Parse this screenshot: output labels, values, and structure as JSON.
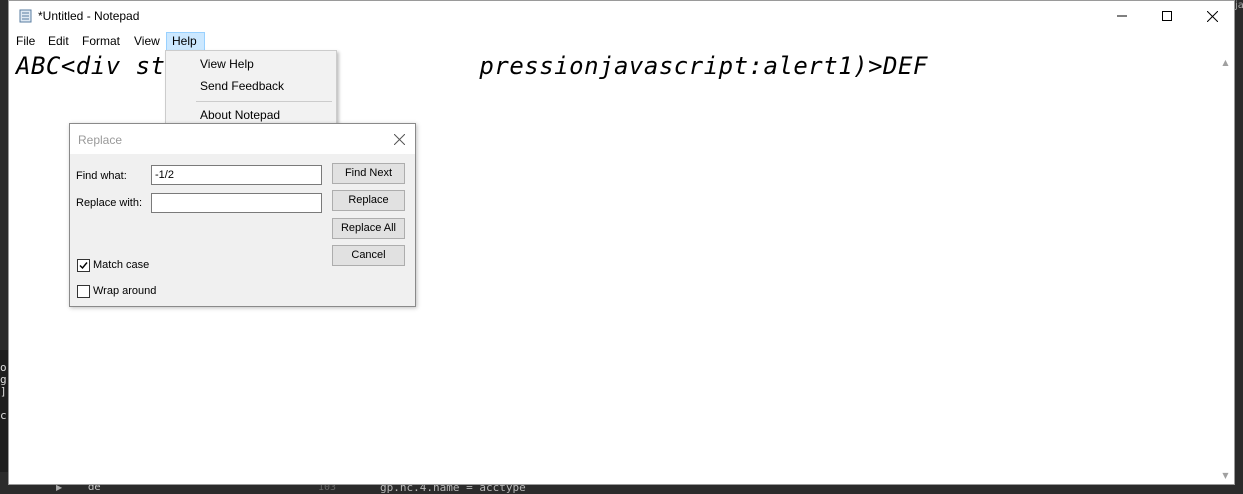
{
  "window": {
    "title": "*Untitled - Notepad",
    "controls": {
      "minimize_icon": "minimize-icon",
      "maximize_icon": "maximize-icon",
      "close_icon": "close-icon"
    }
  },
  "menubar": {
    "items": [
      {
        "label": "File"
      },
      {
        "label": "Edit"
      },
      {
        "label": "Format"
      },
      {
        "label": "View"
      },
      {
        "label": "Help",
        "active": true
      }
    ]
  },
  "help_menu": {
    "items": [
      {
        "label": "View Help"
      },
      {
        "label": "Send Feedback"
      },
      {
        "label": "About Notepad"
      }
    ]
  },
  "editor": {
    "text": "ABC<div style=\"width:expressionjavascript:alert1)>DEF",
    "visible_text": "ABC<div sty                    pressionjavascript:alert1)>DEF"
  },
  "replace_dialog": {
    "title": "Replace",
    "find_label": "Find what:",
    "find_value": "-1/2",
    "replace_label": "Replace with:",
    "replace_value": "",
    "buttons": {
      "find_next": "Find Next",
      "replace": "Replace",
      "replace_all": "Replace All",
      "cancel": "Cancel"
    },
    "match_case": {
      "label": "Match case",
      "checked": true
    },
    "wrap_around": {
      "label": "Wrap around",
      "checked": false
    }
  },
  "background": {
    "code_line": "gp.nc.4.name = acctype",
    "line_number": "103",
    "tree_item": "de",
    "left_chars": "o\ng\n]\n\nc"
  },
  "colors": {
    "menu_highlight": "#cce8ff",
    "dialog_bg": "#f0f0f0",
    "button_bg": "#e1e1e1"
  }
}
